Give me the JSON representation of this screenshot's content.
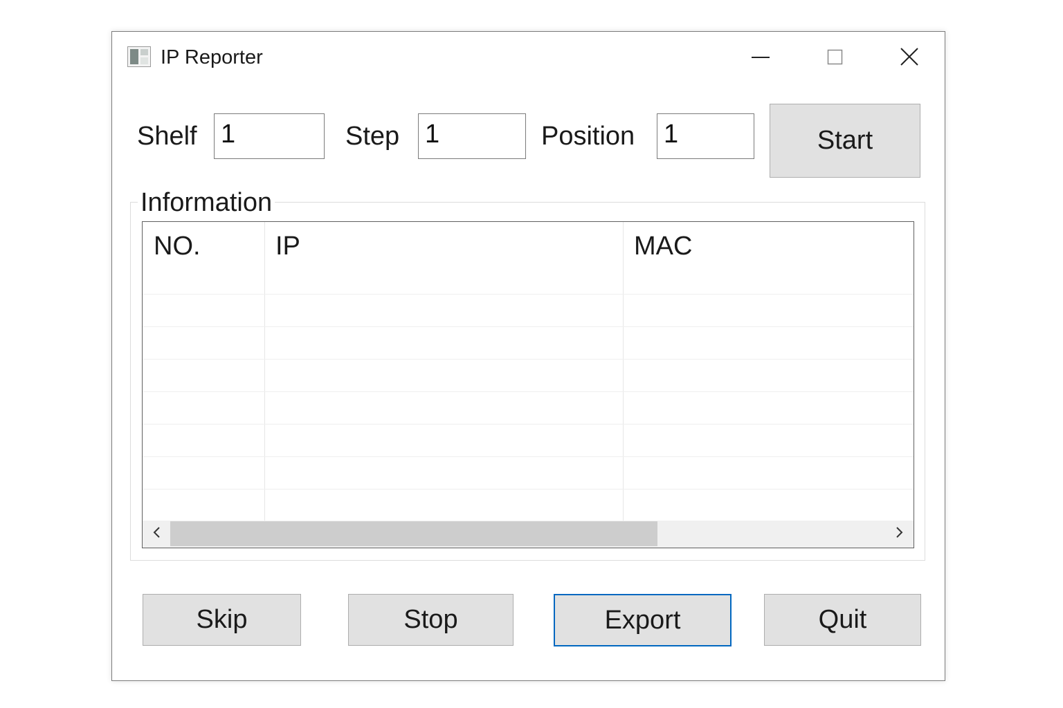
{
  "window": {
    "title": "IP Reporter"
  },
  "icons": {
    "app": "app-icon",
    "minimize": "minimize-icon",
    "maximize": "maximize-icon",
    "close": "close-icon",
    "scroll_left": "chevron-left-icon",
    "scroll_right": "chevron-right-icon"
  },
  "form": {
    "shelf_label": "Shelf",
    "shelf_value": "1",
    "step_label": "Step",
    "step_value": "1",
    "position_label": "Position",
    "position_value": "1",
    "start_label": "Start"
  },
  "information": {
    "title": "Information",
    "columns": [
      "NO.",
      "IP",
      "MAC"
    ],
    "rows": [],
    "scroll_position": 0.0,
    "scroll_visible_fraction": 0.68
  },
  "actions": {
    "skip": "Skip",
    "stop": "Stop",
    "export": "Export",
    "quit": "Quit"
  },
  "colors": {
    "button_face": "#e1e1e1",
    "focus_border": "#0067c0",
    "window_border": "#7a7a7a"
  }
}
